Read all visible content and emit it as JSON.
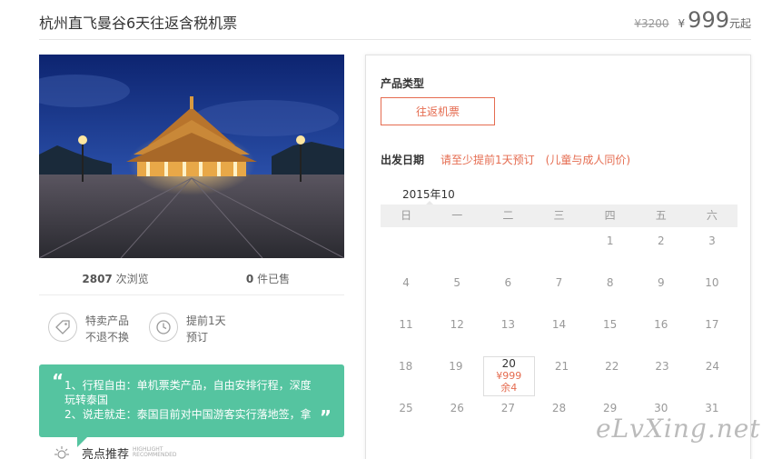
{
  "product": {
    "title": "杭州直飞曼谷6天往返含税机票",
    "original_price": "¥3200",
    "currency": "¥",
    "price": "999",
    "price_suffix": "元起"
  },
  "stats": {
    "views_count": "2807",
    "views_label": "次浏览",
    "sold_count": "0",
    "sold_label": "件已售"
  },
  "features": [
    {
      "icon": "tag-icon",
      "line1": "特卖产品",
      "line2": "不退不换"
    },
    {
      "icon": "clock-icon",
      "line1": "提前1天",
      "line2": "预订"
    }
  ],
  "recommend": {
    "line1": "1、行程自由：单机票类产品，自由安排行程，深度",
    "line2": "玩转泰国",
    "line3": "2、说走就走：泰国目前对中国游客实行落地签，拿",
    "open_quote": "“",
    "close_quote": "”",
    "highlight_label": "亮点推荐",
    "highlight_en_1": "HIGHLIGHT",
    "highlight_en_2": "RECOMMENDED"
  },
  "booking": {
    "type_label": "产品类型",
    "type_option": "往返机票",
    "date_label": "出发日期",
    "date_note": "请至少提前1天预订　(儿童与成人同价)",
    "year_tab": "2015年10",
    "weekdays": [
      "日",
      "一",
      "二",
      "三",
      "四",
      "五",
      "六"
    ],
    "weeks": [
      [
        "",
        "",
        "",
        "",
        "1",
        "2",
        "3"
      ],
      [
        "4",
        "5",
        "6",
        "7",
        "8",
        "9",
        "10"
      ],
      [
        "11",
        "12",
        "13",
        "14",
        "15",
        "16",
        "17"
      ],
      [
        "18",
        "19",
        "20",
        "21",
        "22",
        "23",
        "24"
      ],
      [
        "25",
        "26",
        "27",
        "28",
        "29",
        "30",
        "31"
      ]
    ],
    "available_day": "20",
    "available_price": "¥999",
    "available_stock": "余4"
  },
  "watermark": "eLvXing.net",
  "colors": {
    "accent": "#e56c50",
    "green": "#55c4a0",
    "sky": "#1a3a8a",
    "gold": "#f0a030"
  }
}
